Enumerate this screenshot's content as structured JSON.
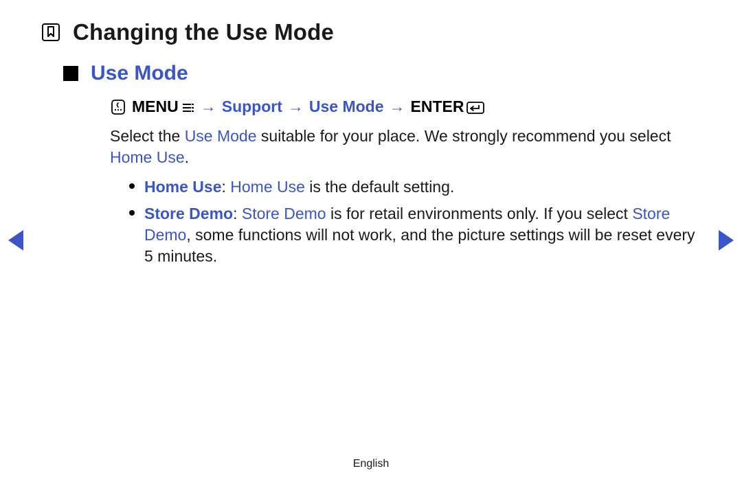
{
  "title": "Changing the Use Mode",
  "section": "Use Mode",
  "path": {
    "menu": "MENU",
    "menu_glyph": "m",
    "arrow": "→",
    "support": "Support",
    "usemode": "Use Mode",
    "enter": "ENTER",
    "enter_glyph": "E"
  },
  "body": {
    "p1a": "Select the ",
    "p1b": "Use Mode",
    "p1c": " suitable for your place. We strongly recommend you select ",
    "p1d": "Home Use",
    "p1e": "."
  },
  "items": {
    "home": {
      "label": "Home Use",
      "sep": ": ",
      "text1": "Home Use",
      "text2": " is the default setting."
    },
    "store": {
      "label": "Store Demo",
      "sep": ": ",
      "text1": "Store Demo",
      "text2": " is for retail environments only. If you select ",
      "text3": "Store Demo",
      "text4": ", some functions will not work, and the picture settings will be reset every 5 minutes."
    }
  },
  "footer": "English"
}
